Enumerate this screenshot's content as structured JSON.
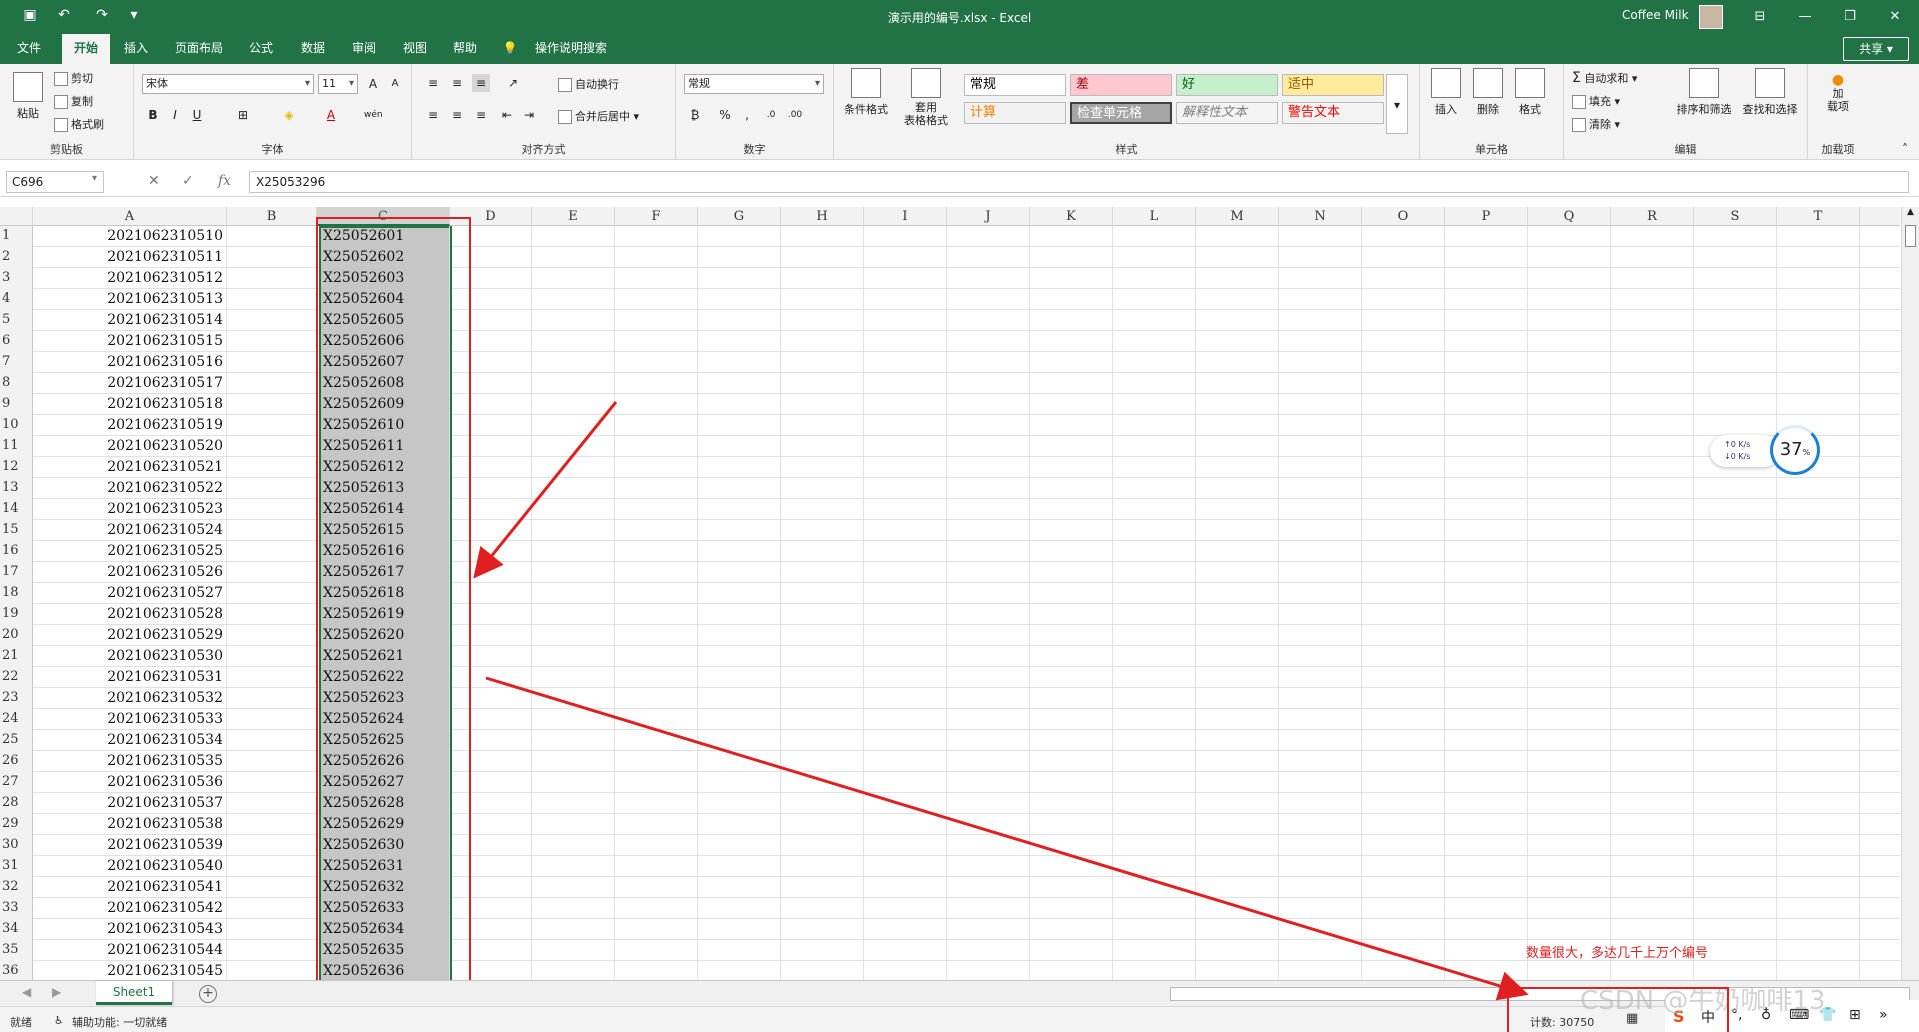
{
  "titlebar": {
    "save_icon": "save-icon",
    "undo_icon": "undo-icon",
    "redo_icon": "redo-icon",
    "doc_title": "演示用的编号.xlsx  -  Excel",
    "user": "Coffee Milk",
    "minimize": "—",
    "restore": "❐",
    "close": "✕",
    "ribbon_display": "⊟"
  },
  "tabs": [
    {
      "label": "文件"
    },
    {
      "label": "开始"
    },
    {
      "label": "插入"
    },
    {
      "label": "页面布局"
    },
    {
      "label": "公式"
    },
    {
      "label": "数据"
    },
    {
      "label": "审阅"
    },
    {
      "label": "视图"
    },
    {
      "label": "帮助"
    },
    {
      "label": "操作说明搜索"
    }
  ],
  "share": "共享",
  "ribbon": {
    "clipboard": {
      "paste": "粘贴",
      "cut": "剪切",
      "copy": "复制",
      "format_painter": "格式刷",
      "label": "剪贴板"
    },
    "font": {
      "name": "宋体",
      "size": "11",
      "label": "字体",
      "bold": "B",
      "italic": "I",
      "underline": "U",
      "wen": "wén"
    },
    "alignment": {
      "wrap": "自动换行",
      "merge": "合并后居中",
      "label": "对齐方式"
    },
    "number": {
      "format": "常规",
      "label": "数字",
      "percent": "%",
      "comma": ","
    },
    "styles": {
      "conditional": "条件格式",
      "table_format": "套用\n表格格式",
      "label": "样式",
      "cells": [
        {
          "text": "常规",
          "bg": "#ffffff",
          "fg": "#000000"
        },
        {
          "text": "差",
          "bg": "#ffc7ce",
          "fg": "#9c0006"
        },
        {
          "text": "好",
          "bg": "#c6efce",
          "fg": "#006100"
        },
        {
          "text": "适中",
          "bg": "#ffeb9c",
          "fg": "#9c5700"
        },
        {
          "text": "计算",
          "bg": "#f2f2f2",
          "fg": "#fa7d00"
        },
        {
          "text": "检查单元格",
          "bg": "#a5a5a5",
          "fg": "#ffffff"
        },
        {
          "text": "解释性文本",
          "bg": "#f3f3f3",
          "fg": "#7f7f7f"
        },
        {
          "text": "警告文本",
          "bg": "#f3f3f3",
          "fg": "#ff0000"
        }
      ]
    },
    "cells_group": {
      "insert": "插入",
      "delete": "删除",
      "format": "格式",
      "label": "单元格"
    },
    "editing": {
      "autosum": "自动求和",
      "fill": "填充",
      "clear": "清除",
      "sort": "排序和筛选",
      "find": "查找和选择",
      "label": "编辑"
    },
    "addins": {
      "addin": "加\n载项",
      "label": "加载项"
    }
  },
  "formula_bar": {
    "name_box": "C696",
    "cancel": "✕",
    "enter": "✓",
    "fx": "fx",
    "value": "X25053296"
  },
  "columns": [
    "A",
    "B",
    "C",
    "D",
    "E",
    "F",
    "G",
    "H",
    "I",
    "J",
    "K",
    "L",
    "M",
    "N",
    "O",
    "P",
    "Q",
    "R",
    "S",
    "T"
  ],
  "rows": [
    {
      "n": "1",
      "a": "2021062310510",
      "c": "X25052601"
    },
    {
      "n": "2",
      "a": "2021062310511",
      "c": "X25052602"
    },
    {
      "n": "3",
      "a": "2021062310512",
      "c": "X25052603"
    },
    {
      "n": "4",
      "a": "2021062310513",
      "c": "X25052604"
    },
    {
      "n": "5",
      "a": "2021062310514",
      "c": "X25052605"
    },
    {
      "n": "6",
      "a": "2021062310515",
      "c": "X25052606"
    },
    {
      "n": "7",
      "a": "2021062310516",
      "c": "X25052607"
    },
    {
      "n": "8",
      "a": "2021062310517",
      "c": "X25052608"
    },
    {
      "n": "9",
      "a": "2021062310518",
      "c": "X25052609"
    },
    {
      "n": "10",
      "a": "2021062310519",
      "c": "X25052610"
    },
    {
      "n": "11",
      "a": "2021062310520",
      "c": "X25052611"
    },
    {
      "n": "12",
      "a": "2021062310521",
      "c": "X25052612"
    },
    {
      "n": "13",
      "a": "2021062310522",
      "c": "X25052613"
    },
    {
      "n": "14",
      "a": "2021062310523",
      "c": "X25052614"
    },
    {
      "n": "15",
      "a": "2021062310524",
      "c": "X25052615"
    },
    {
      "n": "16",
      "a": "2021062310525",
      "c": "X25052616"
    },
    {
      "n": "17",
      "a": "2021062310526",
      "c": "X25052617"
    },
    {
      "n": "18",
      "a": "2021062310527",
      "c": "X25052618"
    },
    {
      "n": "19",
      "a": "2021062310528",
      "c": "X25052619"
    },
    {
      "n": "20",
      "a": "2021062310529",
      "c": "X25052620"
    },
    {
      "n": "21",
      "a": "2021062310530",
      "c": "X25052621"
    },
    {
      "n": "22",
      "a": "2021062310531",
      "c": "X25052622"
    },
    {
      "n": "23",
      "a": "2021062310532",
      "c": "X25052623"
    },
    {
      "n": "24",
      "a": "2021062310533",
      "c": "X25052624"
    },
    {
      "n": "25",
      "a": "2021062310534",
      "c": "X25052625"
    },
    {
      "n": "26",
      "a": "2021062310535",
      "c": "X25052626"
    },
    {
      "n": "27",
      "a": "2021062310536",
      "c": "X25052627"
    },
    {
      "n": "28",
      "a": "2021062310537",
      "c": "X25052628"
    },
    {
      "n": "29",
      "a": "2021062310538",
      "c": "X25052629"
    },
    {
      "n": "30",
      "a": "2021062310539",
      "c": "X25052630"
    },
    {
      "n": "31",
      "a": "2021062310540",
      "c": "X25052631"
    },
    {
      "n": "32",
      "a": "2021062310541",
      "c": "X25052632"
    },
    {
      "n": "33",
      "a": "2021062310542",
      "c": "X25052633"
    },
    {
      "n": "34",
      "a": "2021062310543",
      "c": "X25052634"
    },
    {
      "n": "35",
      "a": "2021062310544",
      "c": "X25052635"
    },
    {
      "n": "36",
      "a": "2021062310545",
      "c": "X25052636"
    }
  ],
  "sheet_tab": "Sheet1",
  "add_sheet": "+",
  "status": {
    "ready": "就绪",
    "accessibility": "辅助功能: 一切就绪",
    "count": "计数: 30750"
  },
  "annotation": {
    "note": "数量很大，多达几千上万个编号",
    "color": "#e02020"
  },
  "network_widget": {
    "up": "↑0  K/s",
    "down": "↓0  K/s",
    "percent": "37",
    "unit": "%"
  },
  "ime": {
    "logo": "S",
    "lang": "中"
  },
  "watermark": "CSDN @牛奶咖啡13"
}
